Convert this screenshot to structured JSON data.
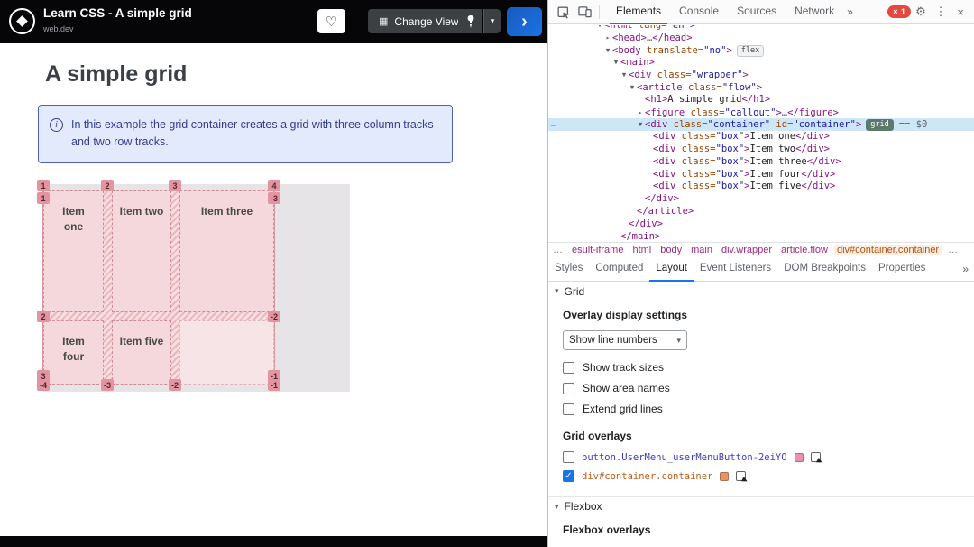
{
  "icons": {
    "heart": "♡",
    "chevron_down": "▾",
    "run_arrow": "›",
    "grid_view": "▦",
    "info": "i",
    "gear": "⚙",
    "kebab": "⋮",
    "close": "×",
    "more_tabs": "»",
    "ellipsis": "…",
    "check": "✓",
    "collapse_arrow": "▾"
  },
  "site": {
    "header": {
      "title": "Learn CSS - A simple grid",
      "subtitle": "web.dev",
      "change_view_label": "Change View"
    },
    "heading": "A simple grid",
    "callout_text": "In this example the grid container creates a grid with three column tracks and two row tracks.",
    "grid": {
      "items": [
        "Item one",
        "Item two",
        "Item three",
        "Item four",
        "Item five"
      ],
      "line_numbers": {
        "top": [
          "1",
          "2",
          "3",
          "4"
        ],
        "bottom": [
          "-4",
          "-3",
          "-2",
          "-1"
        ],
        "left": [
          "1",
          "2",
          "3"
        ],
        "right": [
          "-3",
          "-2",
          "-1"
        ]
      }
    }
  },
  "devtools": {
    "toolbar": {
      "tabs": [
        {
          "label": "Elements",
          "selected": true
        },
        {
          "label": "Console"
        },
        {
          "label": "Sources"
        },
        {
          "label": "Network"
        }
      ],
      "error_count": "1"
    },
    "elements_tree": [
      {
        "indent": 0,
        "arrow": "▼",
        "tokens": [
          [
            "t",
            "<html"
          ],
          [
            "a",
            " lang="
          ],
          [
            "v",
            "\"en\""
          ],
          [
            "t",
            ">"
          ]
        ]
      },
      {
        "indent": 1,
        "arrow": "▸",
        "tokens": [
          [
            "t",
            "<head>"
          ],
          [
            "e",
            "…"
          ],
          [
            "t",
            "</head>"
          ]
        ]
      },
      {
        "indent": 1,
        "arrow": "▼",
        "tokens": [
          [
            "t",
            "<body"
          ],
          [
            "a",
            " translate="
          ],
          [
            "v",
            "\"no\""
          ],
          [
            "t",
            ">"
          ],
          [
            "bf",
            "flex"
          ]
        ]
      },
      {
        "indent": 2,
        "arrow": "▼",
        "tokens": [
          [
            "t",
            "<main>"
          ]
        ]
      },
      {
        "indent": 3,
        "arrow": "▼",
        "tokens": [
          [
            "t",
            "<div"
          ],
          [
            "a",
            " class="
          ],
          [
            "v",
            "\"wrapper\""
          ],
          [
            "t",
            ">"
          ]
        ]
      },
      {
        "indent": 4,
        "arrow": "▼",
        "tokens": [
          [
            "t",
            "<article"
          ],
          [
            "a",
            " class="
          ],
          [
            "v",
            "\"flow\""
          ],
          [
            "t",
            ">"
          ]
        ]
      },
      {
        "indent": 5,
        "arrow": "",
        "tokens": [
          [
            "t",
            "<h1>"
          ],
          [
            "x",
            "A simple grid"
          ],
          [
            "t",
            "</h1>"
          ]
        ]
      },
      {
        "indent": 5,
        "arrow": "▸",
        "tokens": [
          [
            "t",
            "<figure"
          ],
          [
            "a",
            " class="
          ],
          [
            "v",
            "\"callout\""
          ],
          [
            "t",
            ">"
          ],
          [
            "e",
            "…"
          ],
          [
            "t",
            "</figure>"
          ]
        ]
      },
      {
        "indent": 5,
        "arrow": "▼",
        "selected": true,
        "tokens": [
          [
            "t",
            "<div"
          ],
          [
            "a",
            " class="
          ],
          [
            "v",
            "\"container\""
          ],
          [
            "a",
            " id="
          ],
          [
            "v",
            "\"container\""
          ],
          [
            "t",
            ">"
          ],
          [
            "bg",
            "grid"
          ],
          [
            "m",
            "== $0"
          ]
        ]
      },
      {
        "indent": 6,
        "arrow": "",
        "tokens": [
          [
            "t",
            "<div"
          ],
          [
            "a",
            " class="
          ],
          [
            "v",
            "\"box\""
          ],
          [
            "t",
            ">"
          ],
          [
            "x",
            "Item one"
          ],
          [
            "t",
            "</div>"
          ]
        ]
      },
      {
        "indent": 6,
        "arrow": "",
        "tokens": [
          [
            "t",
            "<div"
          ],
          [
            "a",
            " class="
          ],
          [
            "v",
            "\"box\""
          ],
          [
            "t",
            ">"
          ],
          [
            "x",
            "Item two"
          ],
          [
            "t",
            "</div>"
          ]
        ]
      },
      {
        "indent": 6,
        "arrow": "",
        "tokens": [
          [
            "t",
            "<div"
          ],
          [
            "a",
            " class="
          ],
          [
            "v",
            "\"box\""
          ],
          [
            "t",
            ">"
          ],
          [
            "x",
            "Item three"
          ],
          [
            "t",
            "</div>"
          ]
        ]
      },
      {
        "indent": 6,
        "arrow": "",
        "tokens": [
          [
            "t",
            "<div"
          ],
          [
            "a",
            " class="
          ],
          [
            "v",
            "\"box\""
          ],
          [
            "t",
            ">"
          ],
          [
            "x",
            "Item four"
          ],
          [
            "t",
            "</div>"
          ]
        ]
      },
      {
        "indent": 6,
        "arrow": "",
        "tokens": [
          [
            "t",
            "<div"
          ],
          [
            "a",
            " class="
          ],
          [
            "v",
            "\"box\""
          ],
          [
            "t",
            ">"
          ],
          [
            "x",
            "Item five"
          ],
          [
            "t",
            "</div>"
          ]
        ]
      },
      {
        "indent": 5,
        "arrow": "",
        "tokens": [
          [
            "t",
            "</div>"
          ]
        ]
      },
      {
        "indent": 4,
        "arrow": "",
        "tokens": [
          [
            "t",
            "</article>"
          ]
        ]
      },
      {
        "indent": 3,
        "arrow": "",
        "tokens": [
          [
            "t",
            "</div>"
          ]
        ]
      },
      {
        "indent": 2,
        "arrow": "",
        "tokens": [
          [
            "t",
            "</main>"
          ]
        ]
      }
    ],
    "breadcrumbs": [
      {
        "label": "…",
        "dim": true
      },
      {
        "label": "esult-iframe"
      },
      {
        "label": "html"
      },
      {
        "label": "body"
      },
      {
        "label": "main"
      },
      {
        "label": "div.wrapper"
      },
      {
        "label": "article.flow"
      },
      {
        "label": "div#container.container",
        "selected": true
      },
      {
        "label": "…",
        "dim": true
      }
    ],
    "panel_tabs": [
      {
        "label": "Styles"
      },
      {
        "label": "Computed"
      },
      {
        "label": "Layout",
        "selected": true
      },
      {
        "label": "Event Listeners"
      },
      {
        "label": "DOM Breakpoints"
      },
      {
        "label": "Properties"
      }
    ],
    "layout_pane": {
      "grid_section_label": "Grid",
      "overlay_settings_label": "Overlay display settings",
      "dropdown_value": "Show line numbers",
      "option_checkboxes": [
        "Show track sizes",
        "Show area names",
        "Extend grid lines"
      ],
      "grid_overlays_label": "Grid overlays",
      "overlays": [
        {
          "label": "button.UserMenu_userMenuButton-2eiYO",
          "checked": false,
          "swatch": "#ee8fae",
          "label_color": "#3d3dc2"
        },
        {
          "label": "div#container.container",
          "checked": true,
          "swatch": "#e89467",
          "label_color": "#bf5b17"
        }
      ],
      "flexbox_section_label": "Flexbox",
      "flexbox_overlays_label": "Flexbox overlays"
    }
  }
}
